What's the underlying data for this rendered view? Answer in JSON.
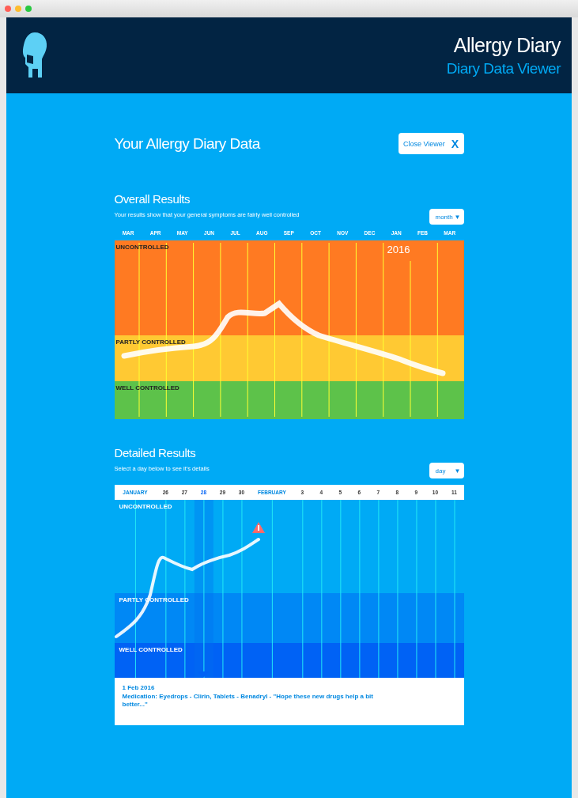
{
  "window": {
    "title_bar": {
      "buttons": [
        {
          "color": "#ff5f57"
        },
        {
          "color": "#febc2e"
        },
        {
          "color": "#28c840"
        }
      ]
    }
  },
  "header": {
    "title": "Allergy Diary",
    "subtitle": "Diary Data Viewer"
  },
  "page_title": "Your Allergy Diary Data",
  "close_button": {
    "label": "Close Viewer",
    "icon": "X"
  },
  "overall": {
    "title": "Overall Results",
    "description": "Your results show that your general symptoms are fairly well controlled",
    "dropdown": {
      "value": "month",
      "caret": "▼"
    },
    "months": [
      "MAR",
      "APR",
      "MAY",
      "JUN",
      "JUL",
      "AUG",
      "SEP",
      "OCT",
      "NOV",
      "DEC",
      "JAN",
      "FEB",
      "MAR"
    ],
    "year_label": "2016",
    "bands": [
      {
        "label": "UNCONTROLLED",
        "color": "#ff7a22"
      },
      {
        "label": "PARTLY CONTROLLED",
        "color": "#ffc933"
      },
      {
        "label": "WELL CONTROLLED",
        "color": "#5dc24a"
      }
    ]
  },
  "detailed": {
    "title": "Detailed Results",
    "description": "Select a day below to see it's details",
    "dropdown": {
      "value": "day",
      "caret": "▼"
    },
    "days": [
      {
        "label": "JANUARY",
        "kind": "month",
        "selected": false
      },
      {
        "label": "26",
        "kind": "day",
        "selected": false
      },
      {
        "label": "27",
        "kind": "day",
        "selected": false
      },
      {
        "label": "28",
        "kind": "day",
        "selected": true
      },
      {
        "label": "29",
        "kind": "day",
        "selected": false
      },
      {
        "label": "30",
        "kind": "day",
        "selected": false
      },
      {
        "label": "FEBRUARY",
        "kind": "month",
        "selected": false
      },
      {
        "label": "3",
        "kind": "day",
        "selected": false
      },
      {
        "label": "4",
        "kind": "day",
        "selected": false
      },
      {
        "label": "5",
        "kind": "day",
        "selected": false
      },
      {
        "label": "6",
        "kind": "day",
        "selected": false
      },
      {
        "label": "7",
        "kind": "day",
        "selected": false
      },
      {
        "label": "8",
        "kind": "day",
        "selected": false
      },
      {
        "label": "9",
        "kind": "day",
        "selected": false
      },
      {
        "label": "10",
        "kind": "day",
        "selected": false
      },
      {
        "label": "11",
        "kind": "day",
        "selected": false
      }
    ],
    "bands": [
      {
        "label": "UNCONTROLLED",
        "color": "#00aaf5"
      },
      {
        "label": "PARTLY CONTROLLED",
        "color": "#0088f5"
      },
      {
        "label": "WELL CONTROLLED",
        "color": "#0062f5"
      }
    ],
    "detail": {
      "date": "1 Feb 2016",
      "note": "Medication: Eyedrops - Clirin, Tablets - Benadryl - \"Hope these new drugs help a bit better...\""
    }
  }
}
